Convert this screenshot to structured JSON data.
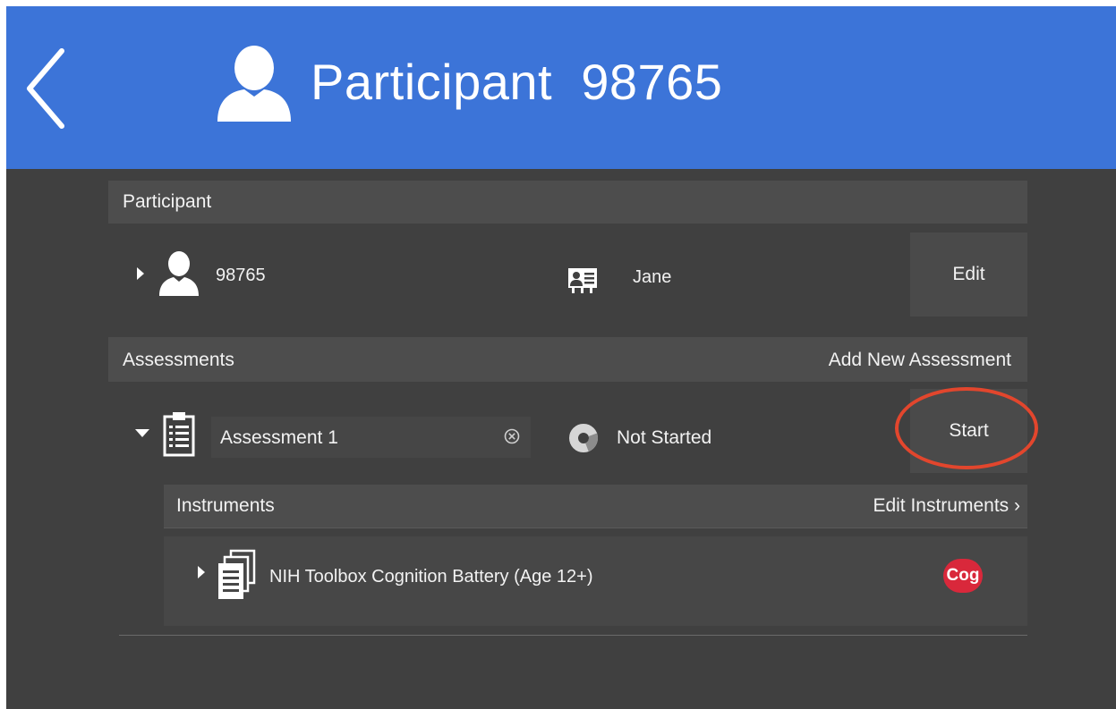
{
  "header": {
    "title": "Participant  98765",
    "back_icon": "chevron-left-icon",
    "user_icon": "user-icon",
    "background": "#3c74d8"
  },
  "participant_section": {
    "label": "Participant",
    "id": "98765",
    "name": "Jane",
    "edit_label": "Edit"
  },
  "assessments_section": {
    "label": "Assessments",
    "add_label": "Add New Assessment",
    "assessment": {
      "name": "Assessment 1",
      "status": "Not Started",
      "start_label": "Start"
    }
  },
  "instruments_section": {
    "label": "Instruments",
    "edit_label": "Edit Instruments ›",
    "items": [
      {
        "name": "NIH Toolbox Cognition Battery (Age 12+)",
        "badge": "Cog",
        "badge_color": "#d9283b"
      }
    ]
  },
  "colors": {
    "background": "#404040",
    "panel": "#4d4d4d",
    "highlight": "#e2462d"
  }
}
